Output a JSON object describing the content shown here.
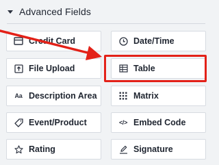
{
  "section": {
    "title": "Advanced Fields",
    "caret_icon": "caret-down-icon"
  },
  "fields": [
    {
      "label": "Credit Card",
      "icon": "credit-card-icon"
    },
    {
      "label": "Date/Time",
      "icon": "clock-icon"
    },
    {
      "label": "File Upload",
      "icon": "file-upload-icon"
    },
    {
      "label": "Table",
      "icon": "table-icon"
    },
    {
      "label": "Description Area",
      "icon": "text-aa-icon",
      "icon_text": "Aa"
    },
    {
      "label": "Matrix",
      "icon": "matrix-grid-icon"
    },
    {
      "label": "Event/Product",
      "icon": "tag-icon"
    },
    {
      "label": "Embed Code",
      "icon": "code-icon",
      "icon_text": "</>"
    },
    {
      "label": "Rating",
      "icon": "star-icon"
    },
    {
      "label": "Signature",
      "icon": "pen-signature-icon"
    }
  ],
  "annotation": {
    "highlighted_field": "Table",
    "color": "#e32118"
  }
}
